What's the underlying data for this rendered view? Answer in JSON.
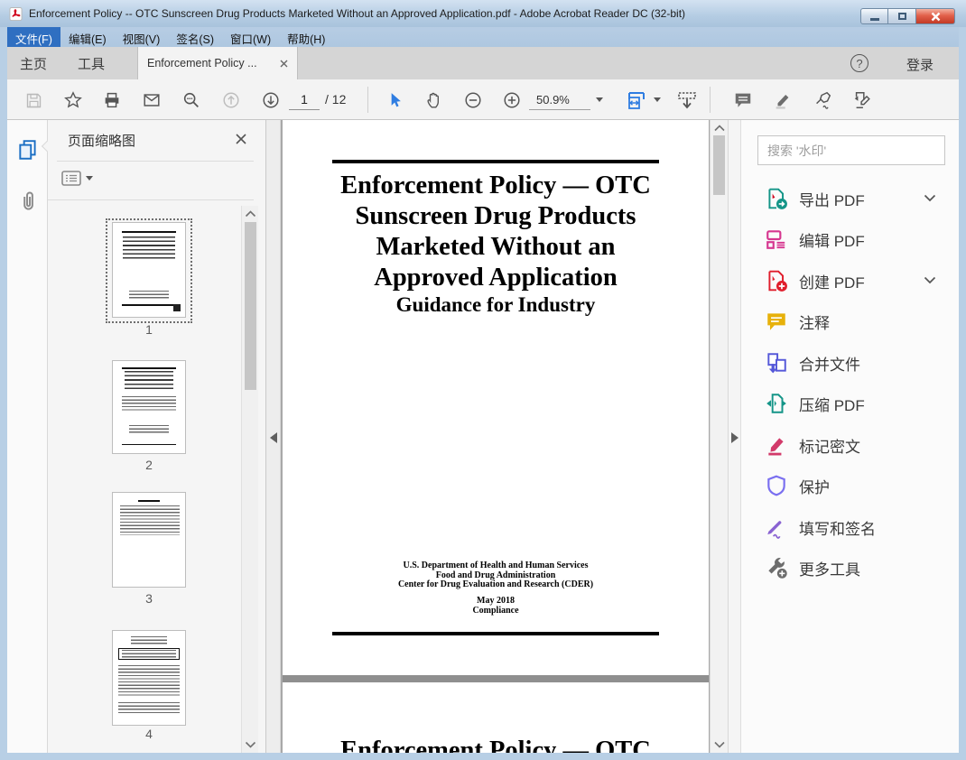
{
  "titlebar": {
    "title": "Enforcement Policy -- OTC  Sunscreen Drug Products Marketed Without an Approved Application.pdf - Adobe Acrobat Reader DC (32-bit)"
  },
  "menubar": {
    "items": [
      {
        "label": "文件(F)",
        "highlighted": true
      },
      {
        "label": "编辑(E)",
        "highlighted": false
      },
      {
        "label": "视图(V)",
        "highlighted": false
      },
      {
        "label": "签名(S)",
        "highlighted": false
      },
      {
        "label": "窗口(W)",
        "highlighted": false
      },
      {
        "label": "帮助(H)",
        "highlighted": false
      }
    ]
  },
  "tabbar": {
    "home_label": "主页",
    "tools_label": "工具",
    "document_tab_label": "Enforcement Policy ...",
    "help_glyph": "?",
    "sign_in_label": "登录"
  },
  "toolbar": {
    "page_number": "1",
    "page_total": "/ 12",
    "zoom_value": "50.9%"
  },
  "thumbnails_panel": {
    "title": "页面缩略图",
    "selected_page": "1",
    "pages": [
      {
        "label": "1"
      },
      {
        "label": "2"
      },
      {
        "label": "3"
      },
      {
        "label": "4"
      }
    ]
  },
  "document": {
    "page1": {
      "title_lines": [
        "Enforcement Policy — OTC",
        "Sunscreen Drug Products",
        "Marketed Without an",
        "Approved Application"
      ],
      "subtitle": "Guidance for Industry",
      "org_lines": [
        "U.S. Department of Health and Human Services",
        "Food and Drug Administration",
        "Center for Drug Evaluation and Research (CDER)"
      ],
      "date_line": "May 2018",
      "office_line": "Compliance"
    },
    "page2": {
      "title_partial": "Enforcement Policy — OTC"
    }
  },
  "right_panel": {
    "search_placeholder": "搜索 '水印'",
    "tools": [
      {
        "label": "导出 PDF",
        "has_chevron": true,
        "color": "#149588"
      },
      {
        "label": "编辑 PDF",
        "has_chevron": false,
        "color": "#d6368f"
      },
      {
        "label": "创建 PDF",
        "has_chevron": true,
        "color": "#e01e2c"
      },
      {
        "label": "注释",
        "has_chevron": false,
        "color": "#e7b10a"
      },
      {
        "label": "合并文件",
        "has_chevron": false,
        "color": "#5558d9"
      },
      {
        "label": "压缩 PDF",
        "has_chevron": false,
        "color": "#149588"
      },
      {
        "label": "标记密文",
        "has_chevron": false,
        "color": "#d23a6a"
      },
      {
        "label": "保护",
        "has_chevron": false,
        "color": "#7a6ff0"
      },
      {
        "label": "填写和签名",
        "has_chevron": false,
        "color": "#8a63d2"
      },
      {
        "label": "更多工具",
        "has_chevron": false,
        "color": "#6d6d6d"
      }
    ]
  },
  "colors": {
    "titlebar_glass": "#b4cce3",
    "menu_highlight": "#2f6fc1",
    "selection_pointer_blue": "#2f7de1",
    "document_canvas_gray": "#a8a8a8",
    "close_button_red": "#c23a26"
  }
}
